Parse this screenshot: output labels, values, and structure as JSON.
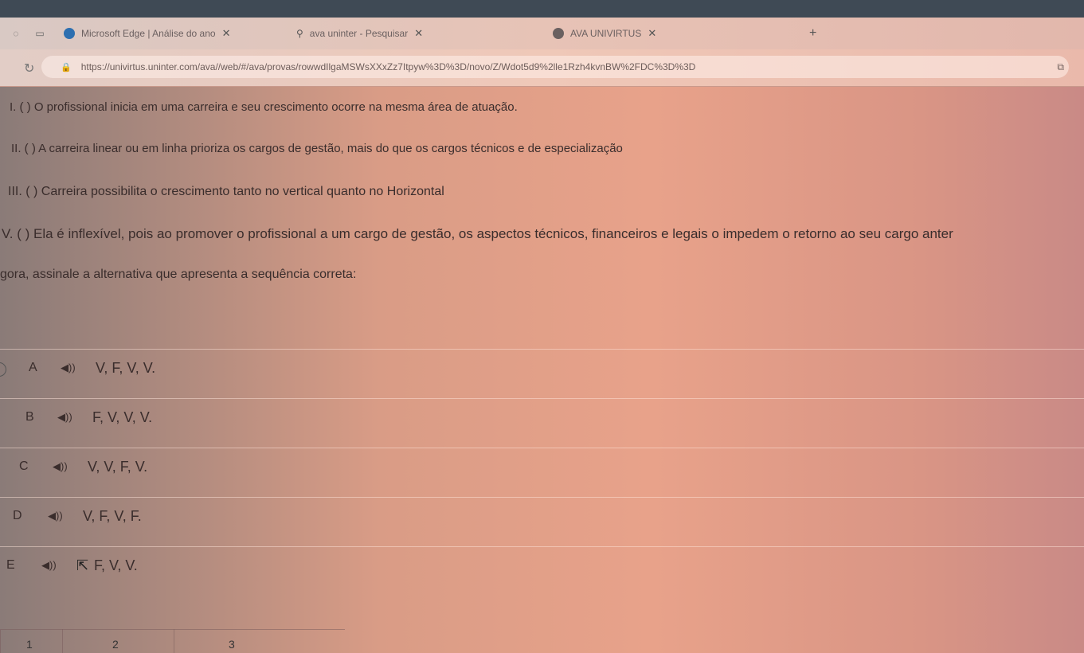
{
  "browser": {
    "tabs": [
      {
        "title": "Microsoft Edge | Análise do ano",
        "close": "✕"
      },
      {
        "title": "ava uninter - Pesquisar",
        "close": "✕"
      },
      {
        "title": "AVA UNIVIRTUS",
        "close": "✕"
      }
    ],
    "new_tab": "+",
    "url": "https://univirtus.uninter.com/ava//web/#/ava/provas/rowwdIlgaMSWsXXxZz7Itpyw%3D%3D/novo/Z/Wdot5d9%2lle1Rzh4kvnBW%2FDC%3D%3D"
  },
  "question": {
    "statements": [
      "I. ( ) O profissional inicia em uma carreira e seu crescimento ocorre na mesma área de atuação.",
      "II. ( ) A carreira linear ou em linha prioriza os cargos de gestão, mais do que os cargos técnicos e de especialização",
      "III. ( ) Carreira possibilita o crescimento tanto no vertical quanto no Horizontal",
      "V. ( ) Ela é inflexível, pois ao promover o profissional a um cargo de gestão, os aspectos técnicos, financeiros e legais o impedem o retorno ao seu cargo anter"
    ],
    "prompt": "gora, assinale a alternativa que apresenta a sequência correta:"
  },
  "options": [
    {
      "letter": "A",
      "text": "V, F, V, V."
    },
    {
      "letter": "B",
      "text": "F, V, V, V."
    },
    {
      "letter": "C",
      "text": "V, V, F, V."
    },
    {
      "letter": "D",
      "text": "V, F, V, F."
    },
    {
      "letter": "E",
      "text": "F, V, V."
    }
  ],
  "bottom_tabs": [
    "1",
    "2",
    "3"
  ],
  "icons": {
    "speaker": "speaker-icon",
    "cursor": "mouse-cursor-icon"
  }
}
